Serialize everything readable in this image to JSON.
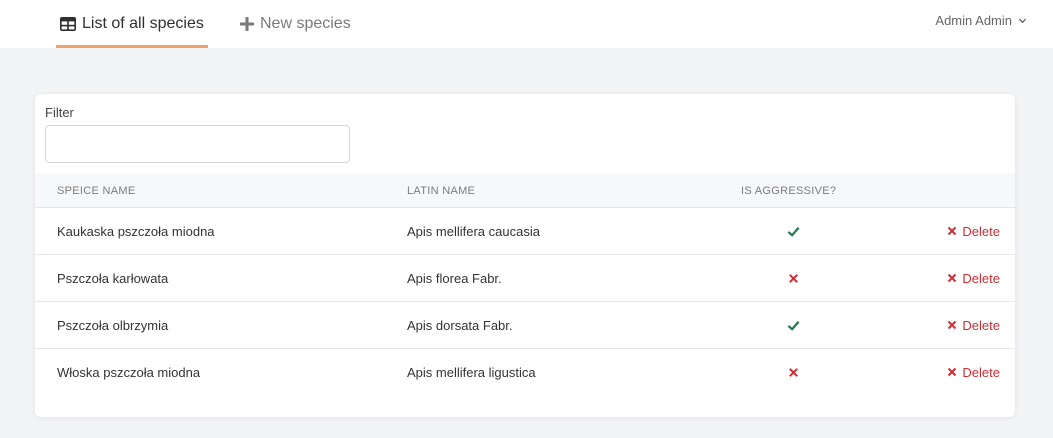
{
  "nav": {
    "tabs": [
      {
        "label": "List of all species",
        "icon": "table-icon",
        "active": true
      },
      {
        "label": "New species",
        "icon": "plus-icon",
        "active": false
      }
    ],
    "user": "Admin Admin"
  },
  "filter": {
    "label": "Filter",
    "value": "",
    "placeholder": ""
  },
  "table": {
    "headers": [
      "SPEICE NAME",
      "LATIN NAME",
      "IS AGGRESSIVE?"
    ],
    "delete_label": "Delete",
    "rows": [
      {
        "name": "Kaukaska pszczoła miodna",
        "latin": "Apis mellifera caucasia",
        "aggressive": true
      },
      {
        "name": "Pszczoła karłowata",
        "latin": "Apis florea Fabr.",
        "aggressive": false
      },
      {
        "name": "Pszczoła olbrzymia",
        "latin": "Apis dorsata Fabr.",
        "aggressive": true
      },
      {
        "name": "Włoska pszczoła miodna",
        "latin": "Apis mellifera ligustica",
        "aggressive": false
      }
    ]
  },
  "colors": {
    "accent": "#f0a068",
    "check": "#1e7a4c",
    "danger": "#cc2f36"
  }
}
